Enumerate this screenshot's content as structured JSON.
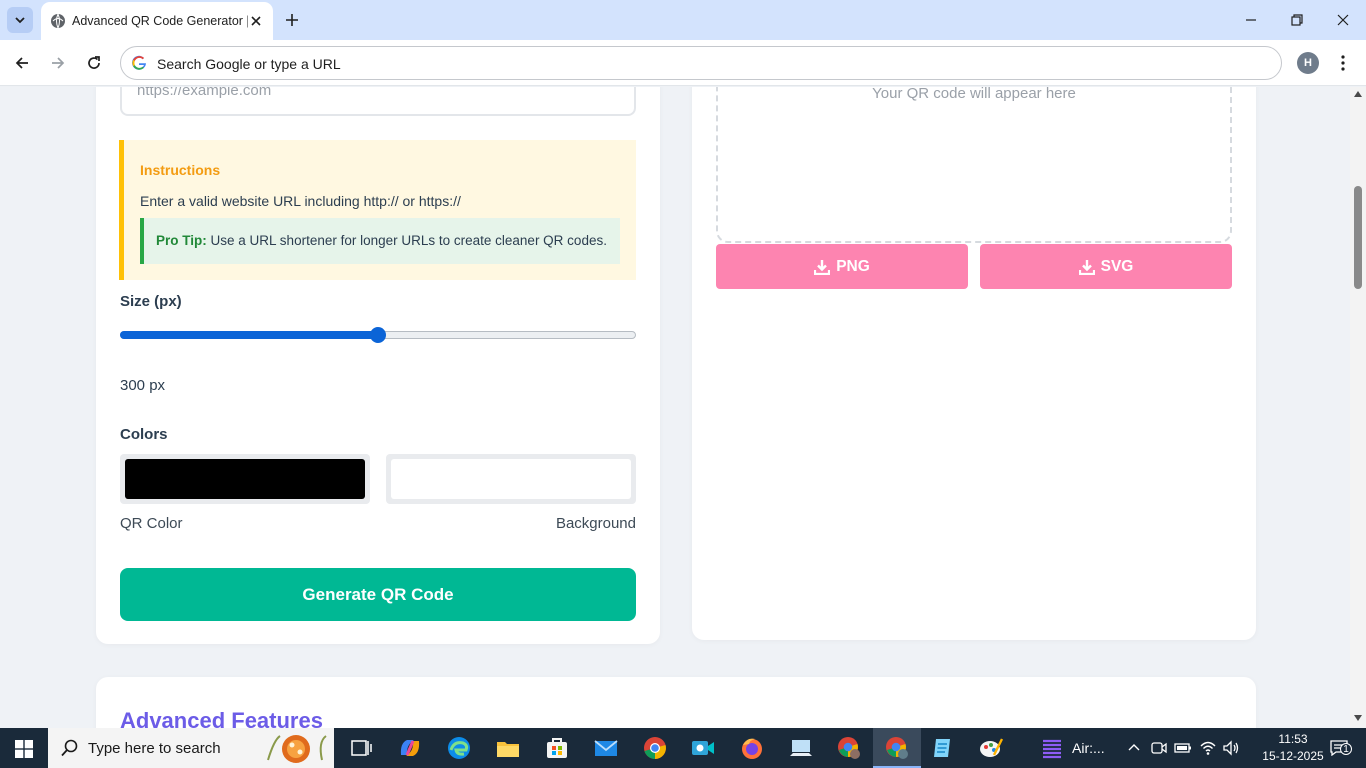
{
  "browser": {
    "tab_title": "Advanced QR Code Generator |",
    "omnibox_placeholder": "Search Google or type a URL",
    "profile_initial": "H"
  },
  "form": {
    "url_placeholder": "https://example.com",
    "instructions": {
      "title": "Instructions",
      "text": "Enter a valid website URL including http:// or https://",
      "pro_tip_label": "Pro Tip:",
      "pro_tip_text": "Use a URL shortener for longer URLs to create cleaner QR codes."
    },
    "size": {
      "label": "Size (px)",
      "value_text": "300 px",
      "slider_fraction": 0.5
    },
    "colors": {
      "label": "Colors",
      "qr_color_label": "QR Color",
      "qr_color": "#000000",
      "background_label": "Background",
      "background_color": "#ffffff"
    },
    "generate_label": "Generate QR Code"
  },
  "preview": {
    "placeholder": "Your QR code will appear here",
    "download_png": "PNG",
    "download_svg": "SVG",
    "download_icon": "download-icon"
  },
  "features": {
    "title": "Advanced Features"
  },
  "taskbar": {
    "search_placeholder": "Type here to search",
    "air_label": "Air:...",
    "time": "11:53",
    "date": "15-12-2025",
    "notification_count": "1"
  },
  "colors": {
    "accent_green": "#00b894",
    "download_pink": "#fd84b0",
    "instruction_orange": "#f39c12",
    "features_purple": "#6c5ce7",
    "slider_blue": "#0b64d7"
  }
}
